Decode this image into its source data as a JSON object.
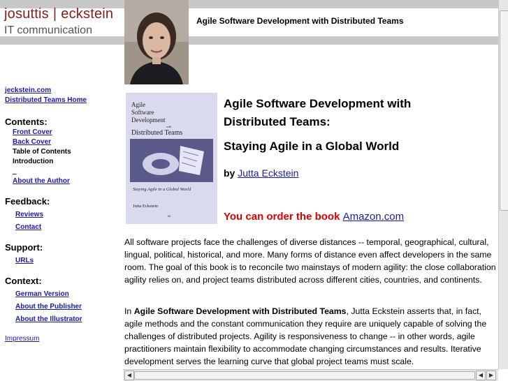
{
  "header": {
    "logo_name_left": "josuttis",
    "logo_separator": "|",
    "logo_name_right": "eckstein",
    "logo_tagline": "IT communication",
    "page_title": "Agile Software Development with Distributed Teams"
  },
  "sidebar": {
    "top_links": [
      "jeckstein.com",
      "Distributed Teams Home"
    ],
    "contents_heading": "Contents:",
    "contents_items": [
      {
        "label": "Front Cover",
        "link": true
      },
      {
        "label": "Back Cover",
        "link": true
      },
      {
        "label": "Table of Contents",
        "link": false
      },
      {
        "label": "Introduction",
        "link": false
      },
      {
        "label": "_",
        "link": true
      },
      {
        "label": "About the Author",
        "link": true
      }
    ],
    "feedback_heading": "Feedback:",
    "feedback_items": [
      "Reviews",
      "Contact"
    ],
    "support_heading": "Support:",
    "support_items": [
      "URLs"
    ],
    "context_heading": "Context:",
    "context_items": [
      "German Version",
      "About the Publisher",
      "About the Illustrator"
    ],
    "impressum": "Impressum"
  },
  "cover": {
    "line1": "Agile",
    "line2": "Software",
    "line3": "Development",
    "line4": "with",
    "line5": "Distributed Teams",
    "subtitle": "Staying Agile in a Global World",
    "author": "Jutta Eckstein"
  },
  "main": {
    "title": "Agile Software Development with Distributed Teams:",
    "subtitle": "Staying Agile in a Global World",
    "by_label": "by",
    "author": "Jutta Eckstein",
    "order_text": "You can order the book",
    "order_link": "Amazon.com",
    "para1": "All software projects face the challenges of diverse distances -- temporal, geographical, cultural, lingual, political, historical, and more. Many forms of distance even affect developers in the same room. The goal of this book is to reconcile two mainstays of modern agility: the close collaboration agility relies on, and project teams distributed across different cities, countries, and continents.",
    "para2_lead": "In",
    "para2_bold": "Agile Software Development with Distributed Teams",
    "para2_rest": ", Jutta Eckstein asserts that, in fact, agile methods and the constant communication they require are uniquely capable of solving the challenges of distributed projects. Agility is responsiveness to change -- in other words, agile practitioners maintain flexibility to accommodate changing circumstances and results. Iterative development serves the learning curve that global project teams must scale."
  },
  "colors": {
    "logo": "#8b1a1a",
    "order": "#e00000",
    "link": "#1a1aa6",
    "band": "#c8c8c8"
  }
}
